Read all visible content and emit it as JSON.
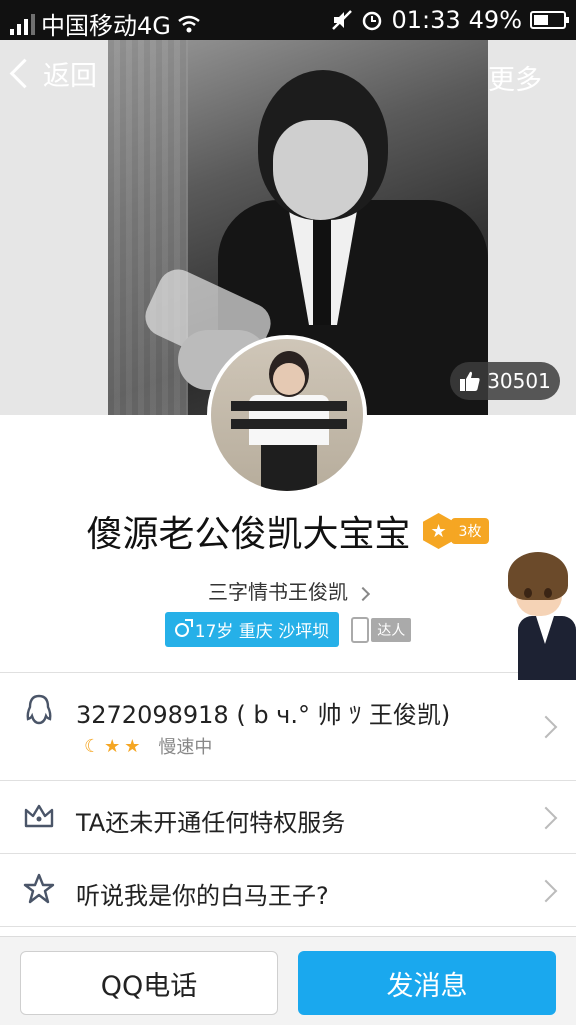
{
  "status_bar": {
    "carrier": "中国移动4G",
    "time": "01:33",
    "battery": "49%"
  },
  "nav": {
    "back_label": "返回",
    "more_label": "更多"
  },
  "likes": "30501",
  "profile": {
    "nickname": "傻源老公俊凯大宝宝",
    "medal_count": "3枚",
    "group": "三字情书王俊凯",
    "info_tag": "17岁  重庆  沙坪坝",
    "talent_tag": "达人"
  },
  "rows": [
    {
      "title": "3272098918 ( b ч.° 帅 ﾂ 王俊凯)",
      "status": "慢速中"
    },
    {
      "title": "TA还未开通任何特权服务"
    },
    {
      "title": "听说我是你的白马王子?"
    }
  ],
  "bottom": {
    "call_label": "QQ电话",
    "message_label": "发消息"
  },
  "colors": {
    "accent": "#1aa8ee",
    "tag_blue": "#26b0e8",
    "medal": "#f5a623"
  }
}
